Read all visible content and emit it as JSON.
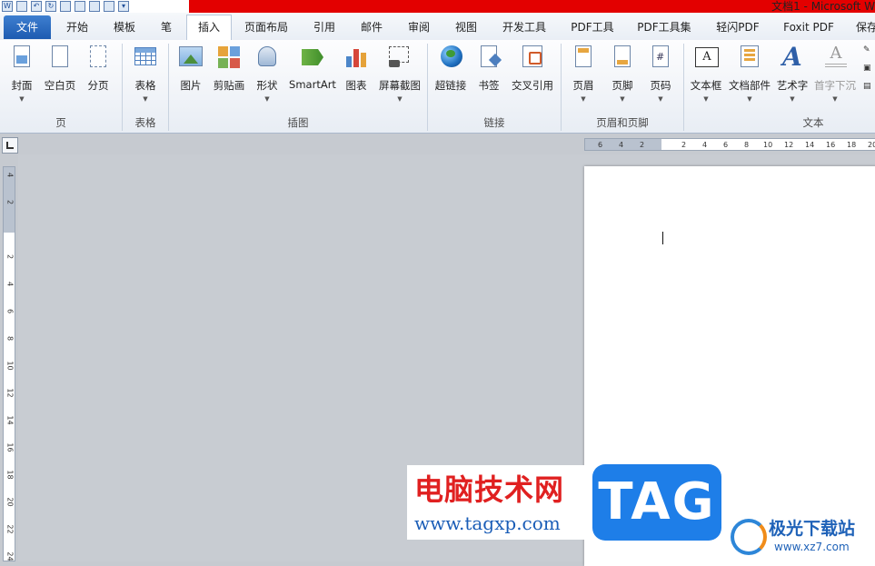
{
  "window": {
    "title": "文档1 - Microsoft W"
  },
  "tabs": [
    {
      "label": "文件"
    },
    {
      "label": "开始"
    },
    {
      "label": "模板"
    },
    {
      "label": "笔"
    },
    {
      "label": "插入"
    },
    {
      "label": "页面布局"
    },
    {
      "label": "引用"
    },
    {
      "label": "邮件"
    },
    {
      "label": "审阅"
    },
    {
      "label": "视图"
    },
    {
      "label": "开发工具"
    },
    {
      "label": "PDF工具"
    },
    {
      "label": "PDF工具集"
    },
    {
      "label": "轻闪PDF"
    },
    {
      "label": "Foxit PDF"
    },
    {
      "label": "保存"
    }
  ],
  "ribbon": {
    "page": {
      "group": "页",
      "cover": "封面",
      "blank": "空白页",
      "break": "分页"
    },
    "table": {
      "group": "表格",
      "table": "表格"
    },
    "illustrations": {
      "group": "插图",
      "picture": "图片",
      "clipart": "剪贴画",
      "shapes": "形状",
      "smartart": "SmartArt",
      "chart": "图表",
      "screenshot": "屏幕截图"
    },
    "links": {
      "group": "链接",
      "hyperlink": "超链接",
      "bookmark": "书签",
      "crossref": "交叉引用"
    },
    "headerfooter": {
      "group": "页眉和页脚",
      "header": "页眉",
      "footer": "页脚",
      "pagenum": "页码"
    },
    "text": {
      "group": "文本",
      "textbox": "文本框",
      "quickparts": "文档部件",
      "wordart": "艺术字",
      "dropcap": "首字下沉"
    }
  },
  "ruler": {
    "h_ticks": [
      "6",
      "4",
      "2",
      "2",
      "4",
      "6",
      "8",
      "10",
      "12",
      "14",
      "16",
      "18",
      "20"
    ],
    "v_ticks": [
      "4",
      "2",
      "2",
      "4",
      "6",
      "8",
      "10",
      "12",
      "14",
      "16",
      "18",
      "20",
      "22",
      "24"
    ]
  },
  "watermarks": {
    "site_cn": "电脑技术网",
    "site_url": "www.tagxp.com",
    "tag": "TAG",
    "site2_cn": "极光下载站",
    "site2_url": "www.xz7.com"
  },
  "colors": {
    "title_red": "#e30000",
    "file_tab": "#1d5bb1",
    "tag_blue": "#1e7ee8"
  }
}
